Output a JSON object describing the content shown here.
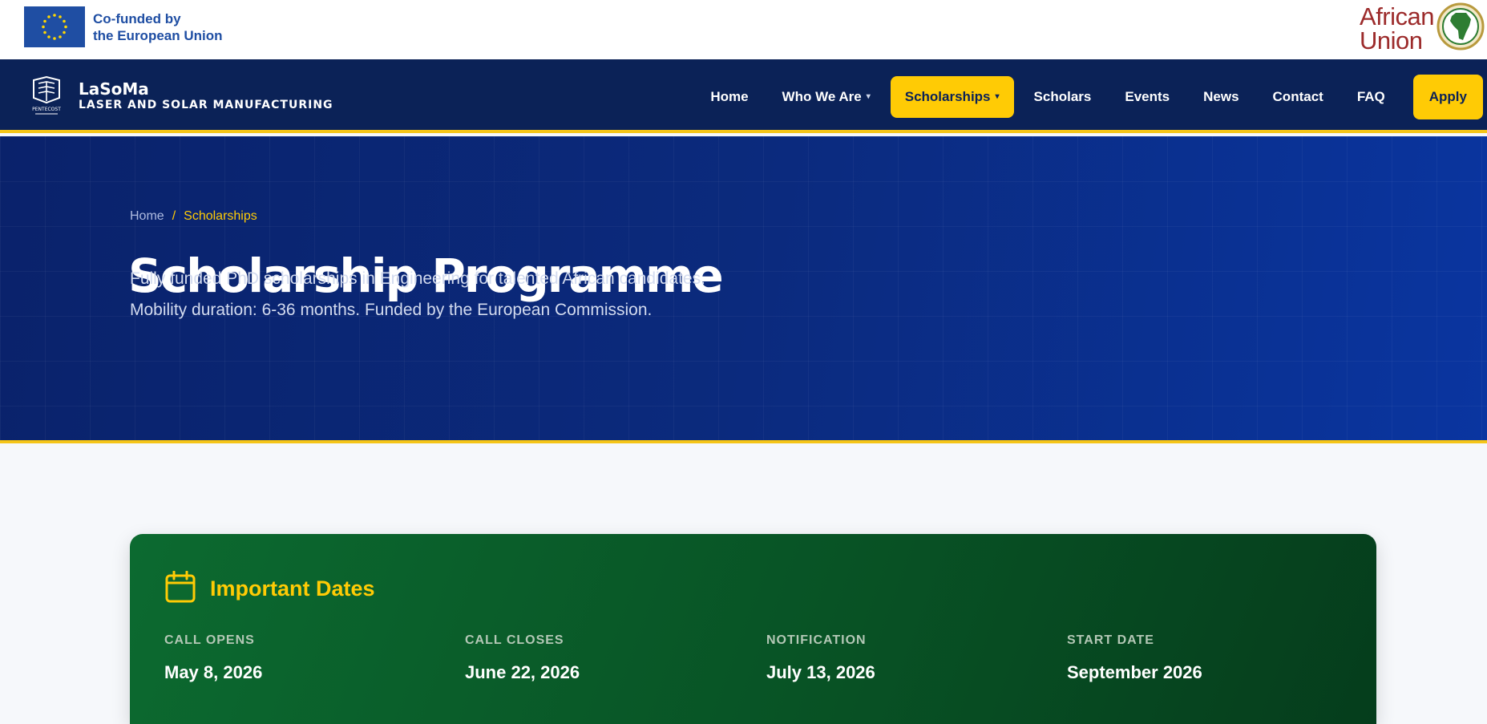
{
  "partners": {
    "eu_text_line1": "Co-funded by",
    "eu_text_line2": "the European Union",
    "au_text_line1": "African",
    "au_text_line2": "Union"
  },
  "brand": {
    "name": "LaSoMa",
    "subtitle": "LASER AND SOLAR MANUFACTURING",
    "emblem_text": "PENTECOST"
  },
  "nav": {
    "items": [
      {
        "label": "Home"
      },
      {
        "label": "Who We Are",
        "has_dropdown": true
      },
      {
        "label": "Scholarships",
        "has_dropdown": true,
        "active": true
      },
      {
        "label": "Scholars"
      },
      {
        "label": "Events"
      },
      {
        "label": "News"
      },
      {
        "label": "Contact"
      },
      {
        "label": "FAQ"
      }
    ],
    "apply_label": "Apply"
  },
  "hero": {
    "breadcrumb_home": "Home",
    "breadcrumb_sep": "/",
    "breadcrumb_current": "Scholarships",
    "title": "Scholarship Programme",
    "line1": "Fully funded PhD scholarships in Engineering for talented African candidates.",
    "line2": "Mobility duration: 6-36 months. Funded by the European Commission."
  },
  "dates": {
    "title": "Important Dates",
    "items": [
      {
        "label": "CALL OPENS",
        "value": "May 8, 2026"
      },
      {
        "label": "CALL CLOSES",
        "value": "June 22, 2026"
      },
      {
        "label": "NOTIFICATION",
        "value": "July 13, 2026"
      },
      {
        "label": "START DATE",
        "value": "September 2026"
      }
    ]
  },
  "colors": {
    "navy": "#0b2257",
    "accent_yellow": "#ffcb05",
    "green": "#085325",
    "eu_blue": "#1f4ea3",
    "au_red": "#9c2b2b"
  }
}
